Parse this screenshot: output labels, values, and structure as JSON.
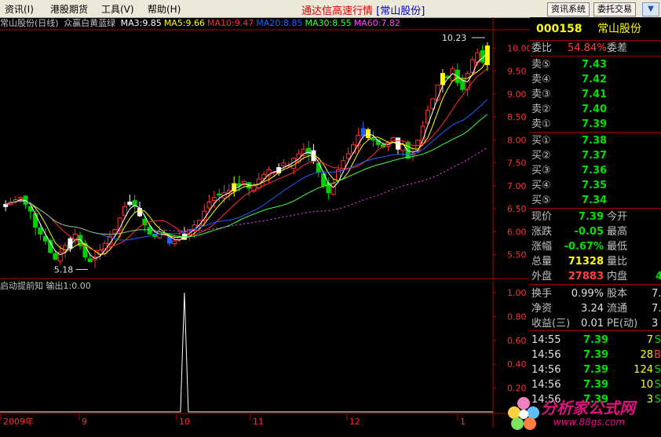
{
  "menu": {
    "items": [
      "资讯(I)",
      "港股期货",
      "工具(V)",
      "帮助(H)"
    ],
    "title_prefix": "通达信高速行情",
    "title_code": "[常山股份]",
    "btn_info": "资讯系统",
    "btn_trade": "委托交易",
    "close_glyph": "▼"
  },
  "chart": {
    "name": "常山股份(日线)",
    "indicator_name": "众赢白黄蓝绿",
    "ma": [
      {
        "label": "MA3:9.85",
        "color": "#ffffff"
      },
      {
        "label": "MA5:9.66",
        "color": "#ffff00"
      },
      {
        "label": "MA10:9.47",
        "color": "#ff3030"
      },
      {
        "label": "MA20:8.85",
        "color": "#2060ff"
      },
      {
        "label": "MA30:8.55",
        "color": "#40ff40"
      },
      {
        "label": "MA60:7.82",
        "color": "#ff40ff"
      }
    ],
    "y_ticks": [
      "10.00",
      "9.50",
      "9.00",
      "8.50",
      "8.00",
      "7.50",
      "7.00",
      "6.50",
      "6.00",
      "5.50"
    ],
    "high_label": "10.23",
    "low_label": "5.18",
    "sub_title": "启动提前知",
    "sub_output": "输出1:0.00",
    "sub_ticks": [
      "1.00",
      "0.80",
      "0.60",
      "0.40",
      "0.20"
    ],
    "x_labels": [
      "2009年",
      "9",
      "10",
      "11",
      "12",
      "1"
    ]
  },
  "chart_data": {
    "type": "line",
    "ylim": [
      5.0,
      10.4
    ],
    "sub_ylim": [
      0,
      1.0
    ],
    "x_labels": [
      "2009年",
      "9",
      "10",
      "11",
      "12",
      "1"
    ],
    "closes": [
      6.6,
      6.65,
      6.7,
      6.75,
      6.6,
      6.45,
      6.1,
      5.95,
      5.8,
      5.55,
      5.4,
      5.55,
      5.7,
      5.85,
      5.95,
      5.7,
      5.45,
      5.35,
      5.45,
      5.6,
      5.75,
      5.9,
      6.05,
      6.3,
      6.55,
      6.65,
      6.55,
      6.35,
      6.15,
      5.95,
      5.9,
      6.0,
      5.95,
      5.75,
      5.8,
      5.9,
      5.95,
      6.05,
      6.15,
      6.25,
      6.45,
      6.65,
      6.75,
      6.8,
      6.85,
      6.9,
      7.05,
      7.0,
      7.1,
      6.95,
      7.0,
      7.15,
      7.25,
      7.35,
      7.3,
      7.4,
      7.5,
      7.45,
      7.6,
      7.7,
      7.8,
      7.7,
      7.55,
      7.3,
      7.0,
      6.85,
      7.05,
      7.35,
      7.55,
      7.7,
      7.9,
      8.1,
      8.25,
      8.05,
      8.0,
      7.9,
      7.85,
      7.95,
      8.05,
      7.8,
      7.9,
      7.6,
      7.7,
      8.0,
      8.3,
      8.65,
      8.9,
      9.2,
      9.45,
      9.35,
      9.55,
      9.25,
      9.1,
      9.45,
      9.75,
      9.9,
      9.7,
      10.05
    ],
    "ma3_last": 9.85,
    "ma5_last": 9.66,
    "ma10_last": 9.47,
    "ma20_last": 8.85,
    "ma30_last": 8.55,
    "ma60_last": 7.82,
    "signal_spike_index": 36,
    "high": 10.23,
    "low": 5.18
  },
  "quote": {
    "code": "000158",
    "name": "常山股份",
    "webi_label": "委比",
    "webi_value": "54.84%",
    "weicha_label": "委差",
    "asks": [
      {
        "label": "卖⑤",
        "price": "7.43"
      },
      {
        "label": "卖④",
        "price": "7.42"
      },
      {
        "label": "卖③",
        "price": "7.41"
      },
      {
        "label": "卖②",
        "price": "7.40"
      },
      {
        "label": "卖①",
        "price": "7.39"
      }
    ],
    "bids": [
      {
        "label": "买①",
        "price": "7.38"
      },
      {
        "label": "买②",
        "price": "7.37"
      },
      {
        "label": "买③",
        "price": "7.36"
      },
      {
        "label": "买④",
        "price": "7.35"
      },
      {
        "label": "买⑤",
        "price": "7.34"
      }
    ],
    "stats": [
      {
        "l1": "现价",
        "v1": "7.39",
        "c1": "grn",
        "l2": "今开"
      },
      {
        "l1": "涨跌",
        "v1": "-0.05",
        "c1": "grn",
        "l2": "最高"
      },
      {
        "l1": "涨幅",
        "v1": "-0.67%",
        "c1": "grn",
        "l2": "最低"
      },
      {
        "l1": "总量",
        "v1": "71328",
        "c1": "yel",
        "l2": "量比"
      },
      {
        "l1": "外盘",
        "v1": "27883",
        "c1": "red",
        "l2": "内盘",
        "v2": "4"
      }
    ],
    "stats2": [
      {
        "l1": "换手",
        "v1": "0.99%",
        "l2": "股本",
        "v2": "7."
      },
      {
        "l1": "净资",
        "v1": "3.24",
        "l2": "流通",
        "v2": "7."
      },
      {
        "l1": "收益(三)",
        "v1": "0.01",
        "l2": "PE(动)",
        "v2": "3"
      }
    ],
    "ticks": [
      {
        "time": "14:55",
        "price": "7.39",
        "vol": "7",
        "flag": "S"
      },
      {
        "time": "14:56",
        "price": "7.39",
        "vol": "28",
        "flag": "B"
      },
      {
        "time": "14:56",
        "price": "7.39",
        "vol": "124",
        "flag": "S"
      },
      {
        "time": "14:56",
        "price": "7.39",
        "vol": "10",
        "flag": "S"
      },
      {
        "time": "14:56",
        "price": "7.39",
        "vol": "3",
        "flag": "S"
      }
    ]
  },
  "watermark": {
    "text": "分析家公式网",
    "url": "www.88gs.com"
  }
}
